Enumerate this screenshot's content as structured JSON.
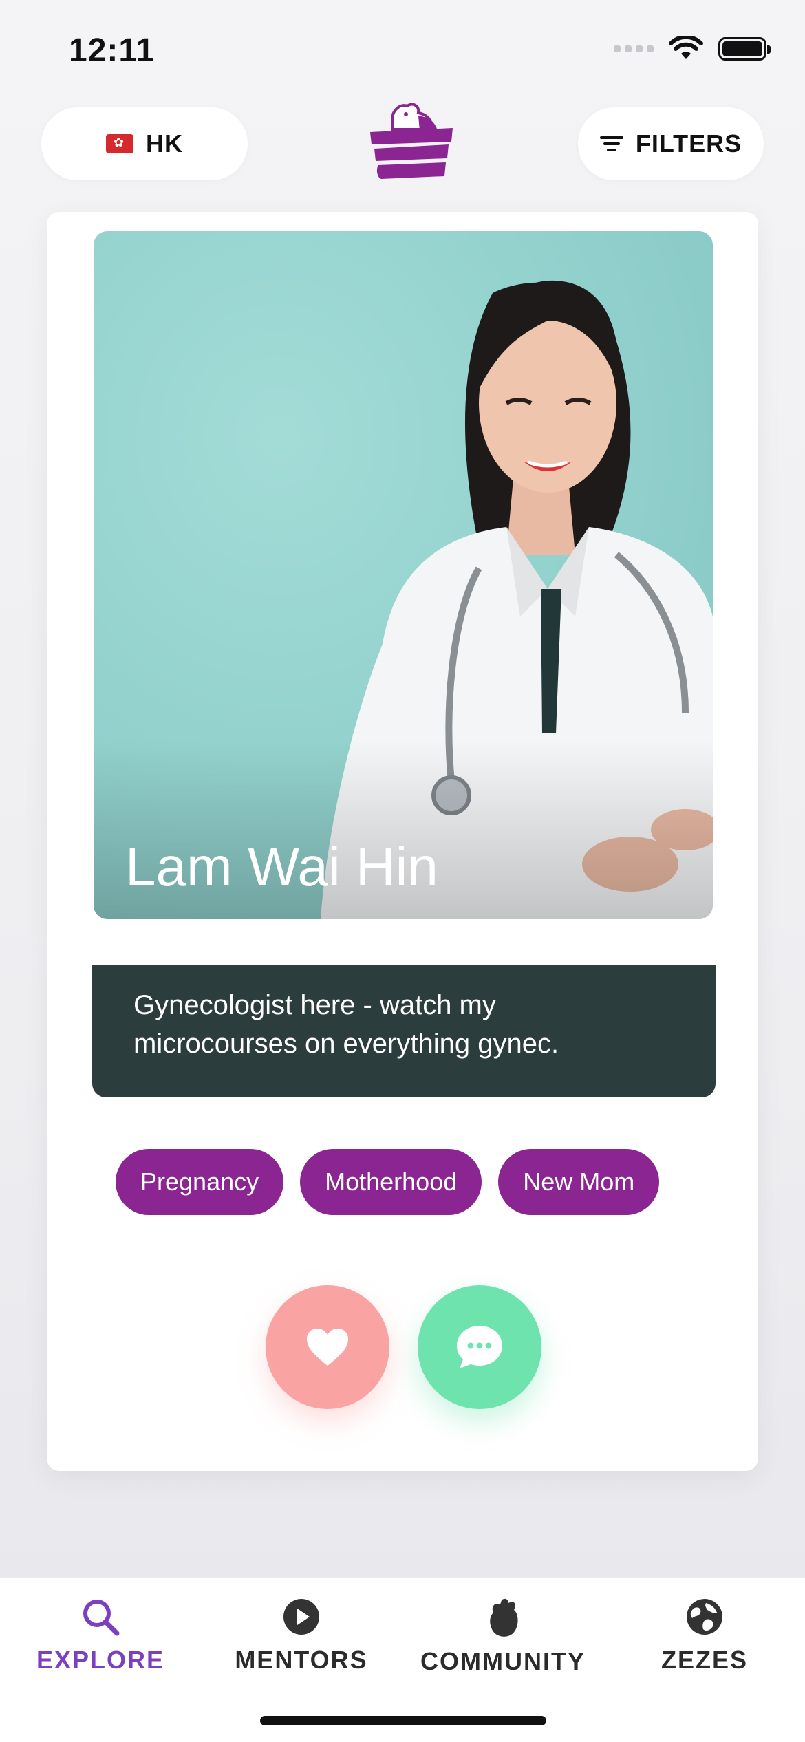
{
  "status": {
    "time": "12:11"
  },
  "top_bar": {
    "country": "HK",
    "filters_label": "FILTERS"
  },
  "profile": {
    "name": "Lam Wai Hin",
    "bio_line1": "Gynecologist here - watch my",
    "bio_line2": "microcourses on  everything gynec.",
    "tags": [
      "Pregnancy",
      "Motherhood",
      "New Mom"
    ]
  },
  "tabs": [
    {
      "label": "EXPLORE",
      "icon": "search-icon",
      "active": true
    },
    {
      "label": "MENTORS",
      "icon": "play-icon",
      "active": false
    },
    {
      "label": "COMMUNITY",
      "icon": "fist-icon",
      "active": false
    },
    {
      "label": "ZEZES",
      "icon": "globe-icon",
      "active": false
    }
  ],
  "colors": {
    "brand_purple": "#8a2592",
    "explore_active": "#7b3fbf",
    "like": "#f9a4a2",
    "chat": "#6ee3ad",
    "bio_bg": "#2c3d3d"
  }
}
